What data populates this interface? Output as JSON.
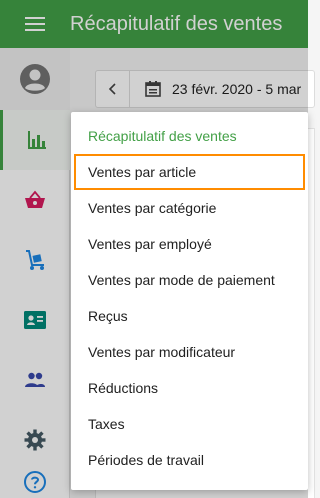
{
  "appbar": {
    "title": "Récapitulatif des ventes",
    "menu_icon": "hamburger-menu-icon",
    "background": "#43a047"
  },
  "date_range": {
    "text": "23 févr. 2020 - 5 mar"
  },
  "sidebar": {
    "items": [
      {
        "name": "account",
        "icon": "account-circle-icon"
      },
      {
        "name": "reports",
        "icon": "bar-chart-icon",
        "active": true
      },
      {
        "name": "items",
        "icon": "basket-icon"
      },
      {
        "name": "inventory",
        "icon": "hand-truck-icon"
      },
      {
        "name": "employees",
        "icon": "id-card-icon"
      },
      {
        "name": "customers",
        "icon": "people-icon"
      },
      {
        "name": "settings",
        "icon": "gear-icon"
      },
      {
        "name": "help",
        "icon": "help-icon"
      }
    ]
  },
  "menu": {
    "header": "Récapitulatif des ventes",
    "items": [
      "Ventes par article",
      "Ventes par catégorie",
      "Ventes par employé",
      "Ventes par mode de paiement",
      "Reçus",
      "Ventes par modificateur",
      "Réductions",
      "Taxes",
      "Périodes de travail"
    ],
    "selected_index": 0
  },
  "colors": {
    "accent": "#43a047",
    "highlight": "#ff8c00"
  }
}
